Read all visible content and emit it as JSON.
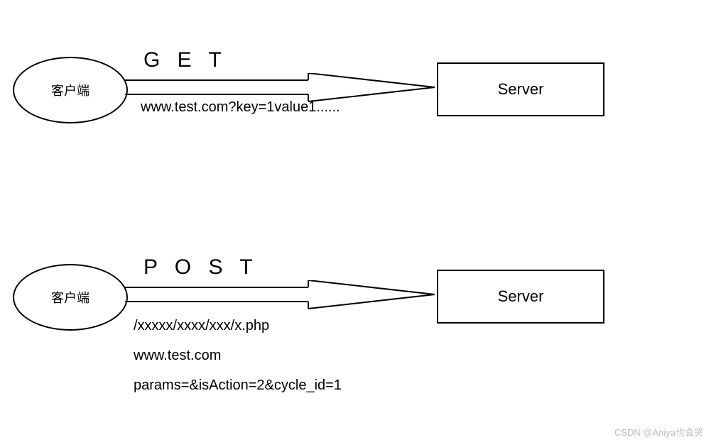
{
  "get_section": {
    "client_label": "客户端",
    "method_label": "G E T",
    "url_text": "www.test.com?key=1value1......",
    "server_label": "Server"
  },
  "post_section": {
    "client_label": "客户端",
    "method_label": "P O S T",
    "path_text": "/xxxxx/xxxx/xxx/x.php",
    "host_text": "www.test.com",
    "params_text": "params=&isAction=2&cycle_id=1",
    "server_label": "Server"
  },
  "watermark": "CSDN @Aniya也会哭"
}
